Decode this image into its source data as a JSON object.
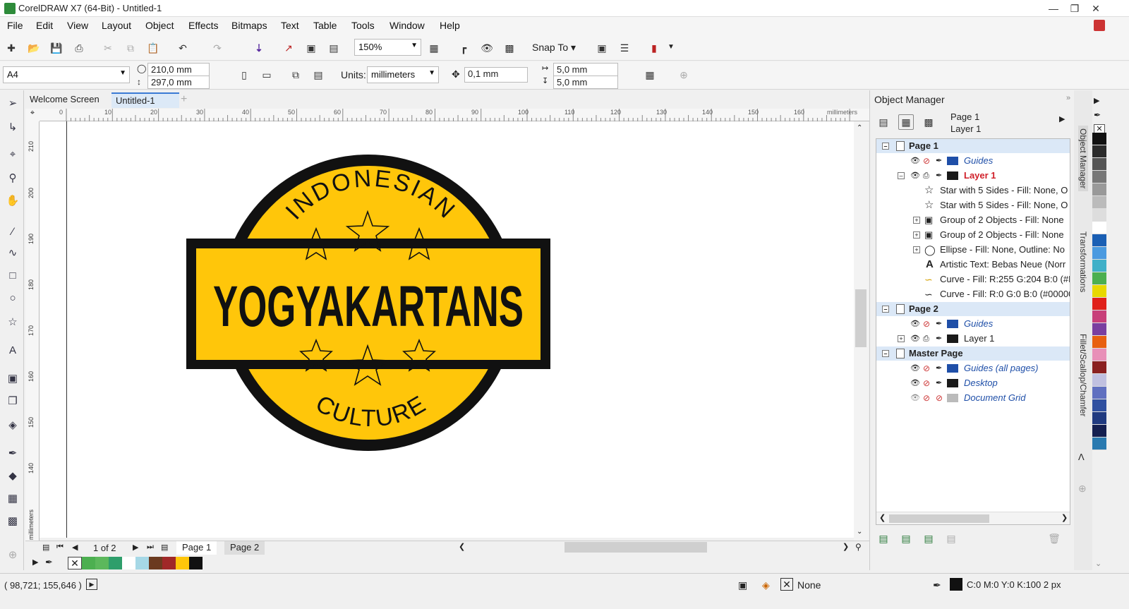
{
  "app": {
    "title": "CorelDRAW X7 (64-Bit) - Untitled-1"
  },
  "menu": [
    "File",
    "Edit",
    "View",
    "Layout",
    "Object",
    "Effects",
    "Bitmaps",
    "Text",
    "Table",
    "Tools",
    "Window",
    "Help"
  ],
  "toolbar": {
    "zoom": "150%",
    "snap": "Snap To"
  },
  "propbar": {
    "page_size": "A4",
    "width": "210,0 mm",
    "height": "297,0 mm",
    "units_label": "Units:",
    "units": "millimeters",
    "nudge": "0,1 mm",
    "dup_x": "5,0 mm",
    "dup_y": "5,0 mm"
  },
  "tabs": {
    "welcome": "Welcome Screen",
    "doc": "Untitled-1"
  },
  "ruler": {
    "h_ticks": [
      "0",
      "10",
      "20",
      "30",
      "40",
      "50",
      "60",
      "70",
      "80",
      "90",
      "100",
      "110",
      "120",
      "130",
      "140",
      "150",
      "160"
    ],
    "h_unit": "millimeters",
    "v_ticks": [
      "210",
      "200",
      "190",
      "180",
      "170",
      "160",
      "150",
      "140"
    ],
    "v_unit": "millimeters"
  },
  "logo": {
    "top_text": "INDONESIAN",
    "main_text": "YOGYAKARTANS",
    "bottom_text": "CULTURE",
    "fill": "#ffc60a",
    "outline": "#111111"
  },
  "pagenav": {
    "count": "1 of 2",
    "page1": "Page 1",
    "page2": "Page 2"
  },
  "object_manager": {
    "title": "Object Manager",
    "current_page": "Page 1",
    "current_layer": "Layer 1",
    "tree": [
      {
        "type": "header",
        "label": "Page 1"
      },
      {
        "type": "layer",
        "label": "Guides",
        "italic": true,
        "color": "#1f4fa8"
      },
      {
        "type": "layer",
        "label": "Layer 1",
        "red": true,
        "color": "#1a1a1a"
      },
      {
        "type": "obj",
        "label": "Star with 5 Sides - Fill: None, O"
      },
      {
        "type": "obj",
        "label": "Star with 5 Sides - Fill: None, O"
      },
      {
        "type": "obj",
        "label": "Group of 2 Objects - Fill: None"
      },
      {
        "type": "obj",
        "label": "Group of 2 Objects - Fill: None"
      },
      {
        "type": "obj",
        "label": "Ellipse - Fill: None, Outline: No"
      },
      {
        "type": "obj",
        "label": "Artistic Text: Bebas Neue (Norr"
      },
      {
        "type": "obj",
        "label": "Curve - Fill: R:255 G:204 B:0 (#F"
      },
      {
        "type": "obj",
        "label": "Curve - Fill: R:0 G:0 B:0 (#00000"
      },
      {
        "type": "header",
        "label": "Page 2"
      },
      {
        "type": "layer",
        "label": "Guides",
        "italic": true,
        "color": "#1f4fa8"
      },
      {
        "type": "layer",
        "label": "Layer 1",
        "color": "#1a1a1a"
      },
      {
        "type": "header",
        "label": "Master Page"
      },
      {
        "type": "layer",
        "label": "Guides (all pages)",
        "italic": true,
        "color": "#1f4fa8"
      },
      {
        "type": "layer",
        "label": "Desktop",
        "italic": true,
        "color": "#1a1a1a"
      },
      {
        "type": "layer",
        "label": "Document Grid",
        "italic": true,
        "color": "#bbbbbb"
      }
    ]
  },
  "side_tabs": [
    "Object Manager",
    "Transformations",
    "Fillet/Scallop/Chamfer"
  ],
  "palette_bottom": [
    "#4caf50",
    "#5cb85c",
    "#2e9e6b",
    "#ffffff",
    "#a6d8e6",
    "#6b3a1f",
    "#a02828",
    "#ffc60a",
    "#111111"
  ],
  "palette_right": [
    "#111111",
    "#2b2b2b",
    "#555555",
    "#777777",
    "#999999",
    "#bbbbbb",
    "#dddddd",
    "#ffffff",
    "#1a5fb4",
    "#4a9ae0",
    "#40b0c8",
    "#4caf50",
    "#e8d800",
    "#e0201a",
    "#c8407a",
    "#7a3fa0",
    "#e86010",
    "#e890b8",
    "#8a2020",
    "#c0c0e0",
    "#6070c0",
    "#3050a0",
    "#203a80",
    "#141f50",
    "#2a7ab0"
  ],
  "status": {
    "coords": "( 98,721; 155,646 )",
    "fill_label": "None",
    "outline": "C:0 M:0 Y:0 K:100  2 px"
  }
}
